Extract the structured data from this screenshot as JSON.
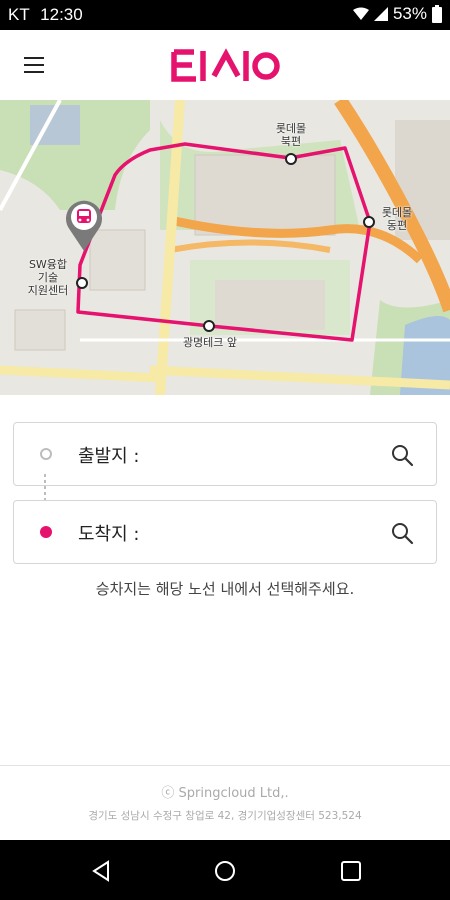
{
  "status_bar": {
    "carrier": "KT",
    "time": "12:30",
    "battery": "53%"
  },
  "app_bar": {
    "logo_text": "티시오",
    "brand_color": "#e5126e"
  },
  "map": {
    "stops": [
      {
        "name": "롯데몰\n북편"
      },
      {
        "name": "롯데몰\n동편"
      },
      {
        "name": "광명테크 앞"
      },
      {
        "name": "SW융합\n기술\n지원센터"
      }
    ],
    "route_color": "#e5126e"
  },
  "origin_field": {
    "label": "출발지 :",
    "icon": "search-icon"
  },
  "destination_field": {
    "label": "도착지 :",
    "icon": "search-icon"
  },
  "hint": "승차지는 해당 노선 내에서 선택해주세요.",
  "footer": {
    "company": "ⓒ Springcloud Ltd,.",
    "address": "경기도 성남시 수정구 창업로 42, 경기기업성장센터 523,524"
  }
}
